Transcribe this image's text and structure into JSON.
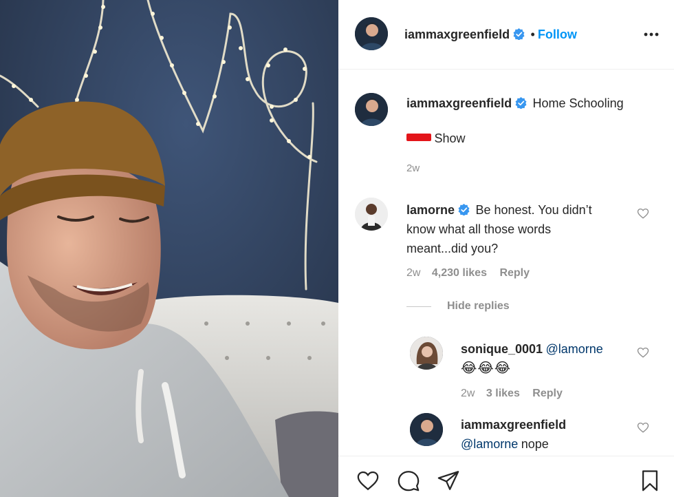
{
  "post": {
    "image_alt": "man in beanie and hoodie smiling in front of string lights"
  },
  "header": {
    "username": "iammaxgreenfield",
    "separator": "•",
    "follow_label": "Follow",
    "more_icon": "more-horizontal-icon"
  },
  "caption": {
    "username": "iammaxgreenfield",
    "text": "Home Schooling",
    "second_line": "Show",
    "time": "2w"
  },
  "comments": [
    {
      "username": "lamorne",
      "verified": true,
      "text_lines": [
        "Be honest. You didn’t",
        "know what all those words",
        "meant...did you?"
      ],
      "time": "2w",
      "likes": "4,230 likes",
      "reply_label": "Reply",
      "hide_replies_label": "Hide replies"
    }
  ],
  "replies": [
    {
      "username": "sonique_0001",
      "mention": "@lamorne",
      "emoji": "😂😂😂",
      "time": "2w",
      "likes": "3 likes",
      "reply_label": "Reply"
    },
    {
      "username": "iammaxgreenfield",
      "mention": "@lamorne",
      "text": "nope"
    }
  ],
  "colors": {
    "accent": "#0095f6",
    "verified": "#3897f0",
    "text": "#262626",
    "muted": "#8e8e8e"
  }
}
